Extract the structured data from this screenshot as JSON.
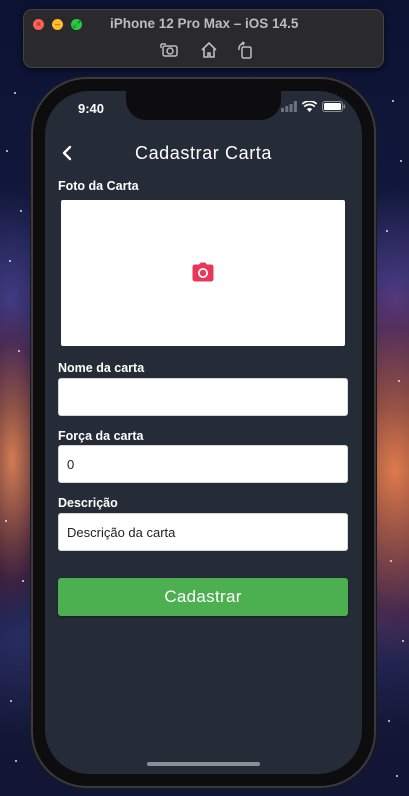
{
  "simulator": {
    "title": "iPhone 12 Pro Max – iOS 14.5",
    "toolbar_icons": [
      "screenshot-icon",
      "home-icon",
      "rotate-icon"
    ]
  },
  "status_bar": {
    "time": "9:40",
    "icons": [
      "signal-icon",
      "wifi-icon",
      "battery-icon"
    ]
  },
  "header": {
    "back_icon": "chevron-left-icon",
    "title": "Cadastrar Carta"
  },
  "form": {
    "photo_label": "Foto da Carta",
    "photo_icon": "camera-icon",
    "name_label": "Nome da carta",
    "name_value": "",
    "strength_label": "Força da carta",
    "strength_value": "0",
    "description_label": "Descrição",
    "description_value": "Descrição da carta",
    "submit_label": "Cadastrar"
  },
  "colors": {
    "screen_background": "#252c37",
    "accent_green": "#4caf50",
    "camera_icon": "#e8385a"
  }
}
